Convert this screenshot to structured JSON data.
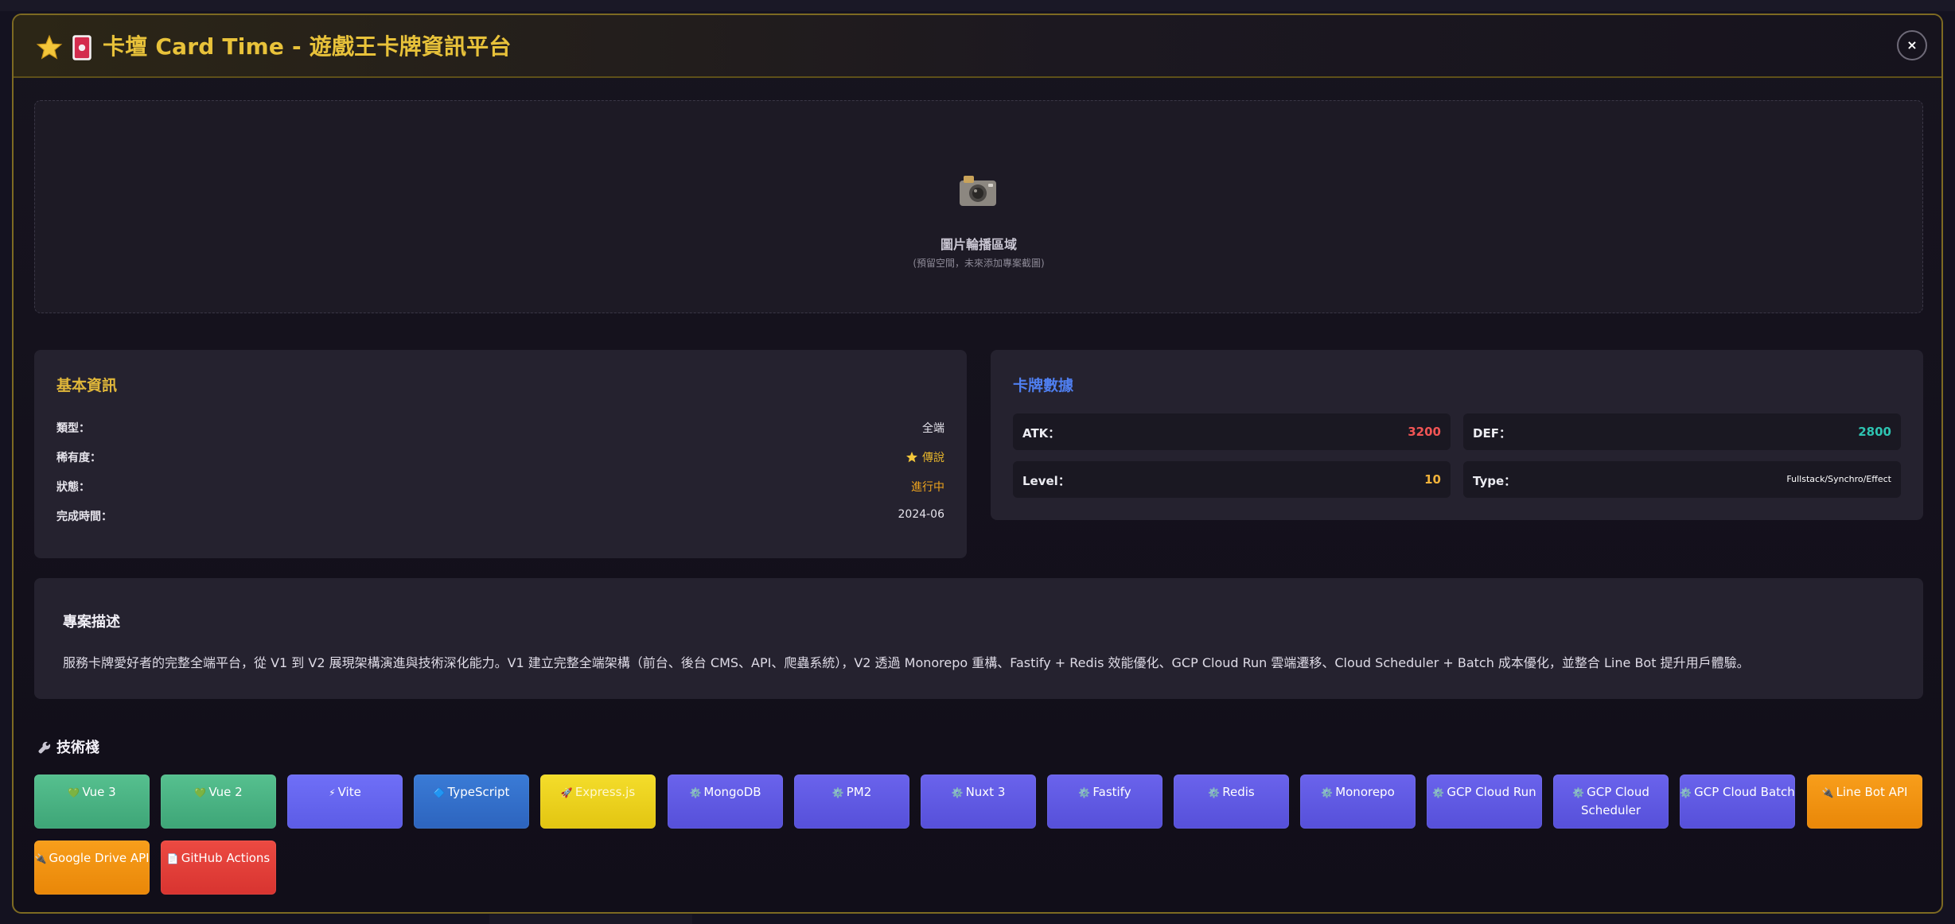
{
  "modal": {
    "title": "卡壇 Card Time - 遊戲王卡牌資訊平台",
    "close_label": "×"
  },
  "carousel": {
    "title": "圖片輪播區域",
    "subtitle": "(預留空間，未來添加專案截圖)",
    "icon": "camera-icon"
  },
  "basic_info": {
    "title": "基本資訊",
    "rows": [
      {
        "label": "類型：",
        "value": "全端"
      },
      {
        "label": "稀有度：",
        "value": "傳說"
      },
      {
        "label": "狀態：",
        "value": "進行中"
      },
      {
        "label": "完成時間：",
        "value": "2024-06"
      }
    ]
  },
  "card_stats": {
    "title": "卡牌數據",
    "atk": {
      "label": "ATK：",
      "value": "3200"
    },
    "def": {
      "label": "DEF：",
      "value": "2800"
    },
    "level": {
      "label": "Level：",
      "value": "10"
    },
    "type": {
      "label": "Type：",
      "value": "Fullstack/Synchro/Effect"
    }
  },
  "description": {
    "title": "專案描述",
    "text": "服務卡牌愛好者的完整全端平台，從 V1 到 V2 展現架構演進與技術深化能力。V1 建立完整全端架構（前台、後台 CMS、API、爬蟲系統），V2 透過 Monorepo 重構、Fastify + Redis 效能優化、GCP Cloud Run 雲端遷移、Cloud Scheduler + Batch 成本優化，並整合 Line Bot 提升用戶體驗。"
  },
  "tech_stack": {
    "title": "技術棧",
    "items": [
      {
        "glyph": "💚",
        "label": "Vue 3"
      },
      {
        "glyph": "💚",
        "label": "Vue 2"
      },
      {
        "glyph": "⚡",
        "label": "Vite"
      },
      {
        "glyph": "🔷",
        "label": "TypeScript"
      },
      {
        "glyph": "🚀",
        "label": "Express.js"
      },
      {
        "glyph": "⚙️",
        "label": "MongoDB"
      },
      {
        "glyph": "⚙️",
        "label": "PM2"
      },
      {
        "glyph": "⚙️",
        "label": "Nuxt 3"
      },
      {
        "glyph": "⚙️",
        "label": "Fastify"
      },
      {
        "glyph": "⚙️",
        "label": "Redis"
      },
      {
        "glyph": "⚙️",
        "label": "Monorepo"
      },
      {
        "glyph": "⚙️",
        "label": "GCP Cloud Run"
      },
      {
        "glyph": "⚙️",
        "label": "GCP Cloud Scheduler"
      },
      {
        "glyph": "⚙️",
        "label": "GCP Cloud Batch"
      },
      {
        "glyph": "🔌",
        "label": "Line Bot API"
      },
      {
        "glyph": "🔌",
        "label": "Google Drive API"
      },
      {
        "glyph": "📄",
        "label": "GitHub Actions"
      }
    ]
  },
  "colors": {
    "accent_gold": "#e8c23a",
    "stats_blue": "#4f7ff0",
    "atk_red": "#f25555",
    "def_teal": "#2ec4b2",
    "level_orange": "#f1b23a"
  }
}
